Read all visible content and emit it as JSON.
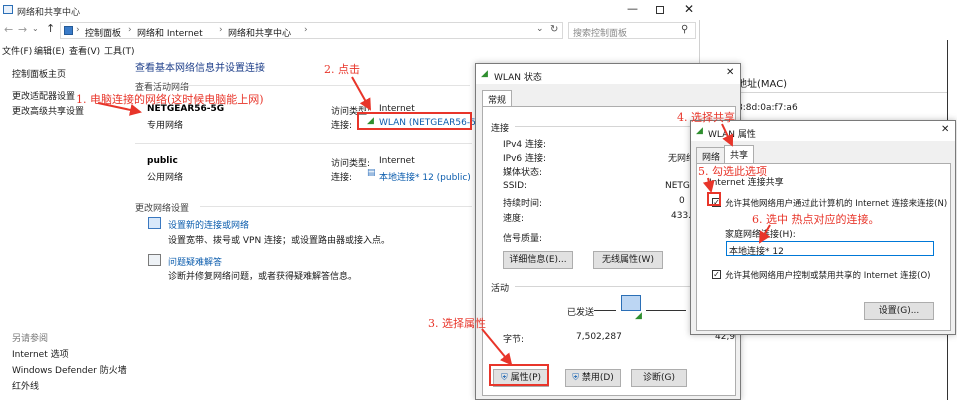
{
  "window": {
    "title": "网络和共享中心",
    "breadcrumb": [
      "控制面板",
      "网络和 Internet",
      "网络和共享中心"
    ],
    "search_placeholder": "搜索控制面板"
  },
  "menu": [
    "文件(F)",
    "编辑(E)",
    "查看(V)",
    "工具(T)"
  ],
  "sidebar": {
    "home": "控制面板主页",
    "items": [
      "更改适配器设置",
      "更改高级共享设置"
    ],
    "see_also_title": "另请参阅",
    "see_also": [
      "Internet 选项",
      "Windows Defender 防火墙",
      "红外线"
    ]
  },
  "main": {
    "heading": "查看基本网络信息并设置连接",
    "active_title": "查看活动网络",
    "networks": [
      {
        "name": "NETGEAR56-5G",
        "type": "专用网络",
        "access_label": "访问类型:",
        "access_value": "Internet",
        "conn_label": "连接:",
        "conn_value": "WLAN (NETGEAR56-5G)"
      },
      {
        "name": "public",
        "type": "公用网络",
        "access_label": "访问类型:",
        "access_value": "Internet",
        "conn_label": "连接:",
        "conn_value": "本地连接* 12 (public)"
      }
    ],
    "change_title": "更改网络设置",
    "tasks": [
      {
        "link": "设置新的连接或网络",
        "desc": "设置宽带、拨号或 VPN 连接；或设置路由器或接入点。"
      },
      {
        "link": "问题疑难解答",
        "desc": "诊断并修复网络问题，或者获得疑难解答信息。"
      }
    ]
  },
  "wlan_status": {
    "title": "WLAN 状态",
    "tab": "常规",
    "section_conn": "连接",
    "rows": [
      {
        "label": "IPv4 连接:",
        "value": ""
      },
      {
        "label": "IPv6 连接:",
        "value": "无网络访"
      },
      {
        "label": "媒体状态:",
        "value": ""
      },
      {
        "label": "SSID:",
        "value": "NETGE"
      },
      {
        "label": "持续时间:",
        "value": "0"
      },
      {
        "label": "速度:",
        "value": "433."
      }
    ],
    "signal_label": "信号质量:",
    "details_btn": "详细信息(E)...",
    "wireless_btn": "无线属性(W)",
    "section_activity": "活动",
    "sent_label": "已发送",
    "bytes_label": "字节:",
    "bytes_sent": "7,502,287",
    "bytes_recv": "42,9",
    "properties_btn": "属性(P)",
    "disable_btn": "禁用(D)",
    "diagnose_btn": "诊断(G)"
  },
  "wlan_props": {
    "title": "WLAN 属性",
    "tabs": [
      "网络",
      "共享"
    ],
    "group_title": "Internet 连接共享",
    "allow_share": "允许其他网络用户通过此计算机的 Internet 连接来连接(N)",
    "home_conn_label": "家庭网络连接(H):",
    "home_conn_value": "本地连接* 12",
    "allow_control": "允许其他网络用户控制或禁用共享的 Internet 连接(O)",
    "settings_btn": "设置(G)..."
  },
  "background": {
    "mac_label": "地址(MAC)",
    "mac_value": "8:8d:0a:f7:a6"
  },
  "annotations": {
    "a1": "1. 电脑连接的网络(这时候电脑能上网)",
    "a2": "2. 点击",
    "a3": "3. 选择属性",
    "a4": "4. 选择共享",
    "a5": "5. 勾选此选项",
    "a6": "6. 选中  热点对应的连接。"
  },
  "colors": {
    "annotation": "#e8352a",
    "link": "#0b5cad",
    "accent": "#0078d7"
  }
}
